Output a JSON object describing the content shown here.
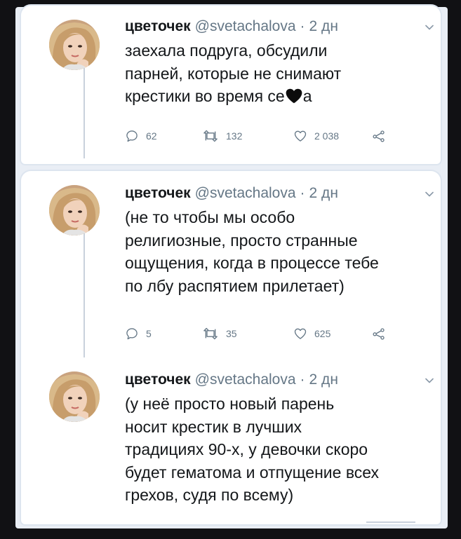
{
  "tweets": [
    {
      "name": "цветочек",
      "handle": "@svetachalova",
      "separator": "·",
      "time": "2 дн",
      "text_before_emoji": "заехала подруга, обсудили\nпарней, которые не снимают\nкрестики во время се",
      "text_after_emoji": "а",
      "emoji": "black-heart",
      "replies": "62",
      "retweets": "132",
      "likes": "2 038"
    },
    {
      "name": "цветочек",
      "handle": "@svetachalova",
      "separator": "·",
      "time": "2 дн",
      "text": "(не то чтобы мы особо\nрелигиозные, просто странные\nощущения, когда в процессе тебе\nпо лбу распятием прилетает)",
      "replies": "5",
      "retweets": "35",
      "likes": "625"
    },
    {
      "name": "цветочек",
      "handle": "@svetachalova",
      "separator": "·",
      "time": "2 дн",
      "text": "(у неё просто новый парень\nносит крестик в лучших\nтрадициях 90-х, у девочки скоро\nбудет гематома и отпущение всех\nгрехов, судя по всему)"
    }
  ],
  "icons": {
    "more": "chevron-down-icon",
    "reply": "reply-icon",
    "retweet": "retweet-icon",
    "like": "heart-icon",
    "share": "share-icon"
  },
  "colors": {
    "name": "#14171a",
    "meta": "#657786",
    "thread_line": "#c9d1dc",
    "background": "#e9eef5"
  }
}
